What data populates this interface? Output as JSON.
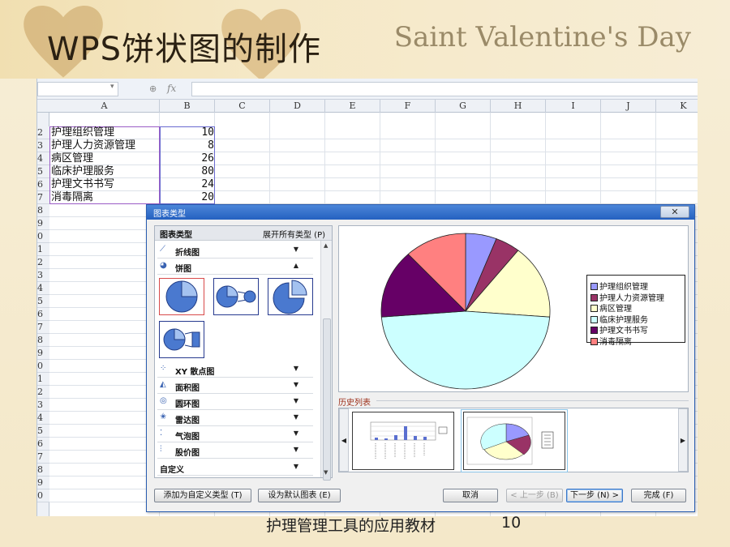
{
  "slide": {
    "title": "WPS饼状图的制作",
    "banner_text": "Saint Valentine's Day",
    "footer_text": "护理管理工具的应用教材",
    "page_number": "10"
  },
  "sheet": {
    "formula_icon": "fx",
    "columns": [
      "A",
      "B",
      "C",
      "D",
      "E",
      "F",
      "G",
      "H",
      "I",
      "J",
      "K"
    ],
    "row_numbers": [
      "2",
      "3",
      "4",
      "5",
      "6",
      "7",
      "8",
      "9",
      "0",
      "1",
      "2",
      "3",
      "4",
      "5",
      "6",
      "7",
      "8",
      "9",
      "0",
      "1",
      "2",
      "3",
      "4",
      "5",
      "6",
      "7",
      "8",
      "9",
      "0"
    ],
    "rows": [
      {
        "label": "护理组织管理",
        "value": "10"
      },
      {
        "label": "护理人力资源管理",
        "value": "8"
      },
      {
        "label": "病区管理",
        "value": "26"
      },
      {
        "label": "临床护理服务",
        "value": "80"
      },
      {
        "label": "护理文书书写",
        "value": "24"
      },
      {
        "label": "消毒隔离",
        "value": "20"
      }
    ]
  },
  "dialog": {
    "title": "图表类型",
    "close_label": "✕",
    "type_header": "图表类型",
    "expand_all": "展开所有类型 (P)",
    "chart_types": [
      {
        "label": "折线图",
        "icon": "line-chart-icon",
        "expanded": false
      },
      {
        "label": "饼图",
        "icon": "pie-chart-icon",
        "expanded": true
      },
      {
        "label": "XY 散点图",
        "icon": "scatter-chart-icon",
        "expanded": false
      },
      {
        "label": "面积图",
        "icon": "area-chart-icon",
        "expanded": false
      },
      {
        "label": "圆环图",
        "icon": "doughnut-chart-icon",
        "expanded": false
      },
      {
        "label": "雷达图",
        "icon": "radar-chart-icon",
        "expanded": false
      },
      {
        "label": "气泡图",
        "icon": "bubble-chart-icon",
        "expanded": false
      },
      {
        "label": "股价图",
        "icon": "stock-chart-icon",
        "expanded": false
      },
      {
        "label": "自定义",
        "icon": "",
        "expanded": false
      }
    ],
    "history_label": "历史列表",
    "buttons": {
      "add_custom": "添加为自定义类型 (T)",
      "set_default": "设为默认图表 (E)",
      "cancel": "取消",
      "prev": "< 上一步 (B)",
      "next": "下一步 (N) >",
      "finish": "完成 (F)"
    }
  },
  "chart_data": {
    "type": "pie",
    "title": "",
    "categories": [
      "护理组织管理",
      "护理人力资源管理",
      "病区管理",
      "临床护理服务",
      "护理文书书写",
      "消毒隔离"
    ],
    "values": [
      10,
      8,
      26,
      80,
      24,
      20
    ],
    "colors": [
      "#9999ff",
      "#993366",
      "#ffffcc",
      "#ccffff",
      "#660066",
      "#ff8080"
    ],
    "legend_position": "right"
  }
}
